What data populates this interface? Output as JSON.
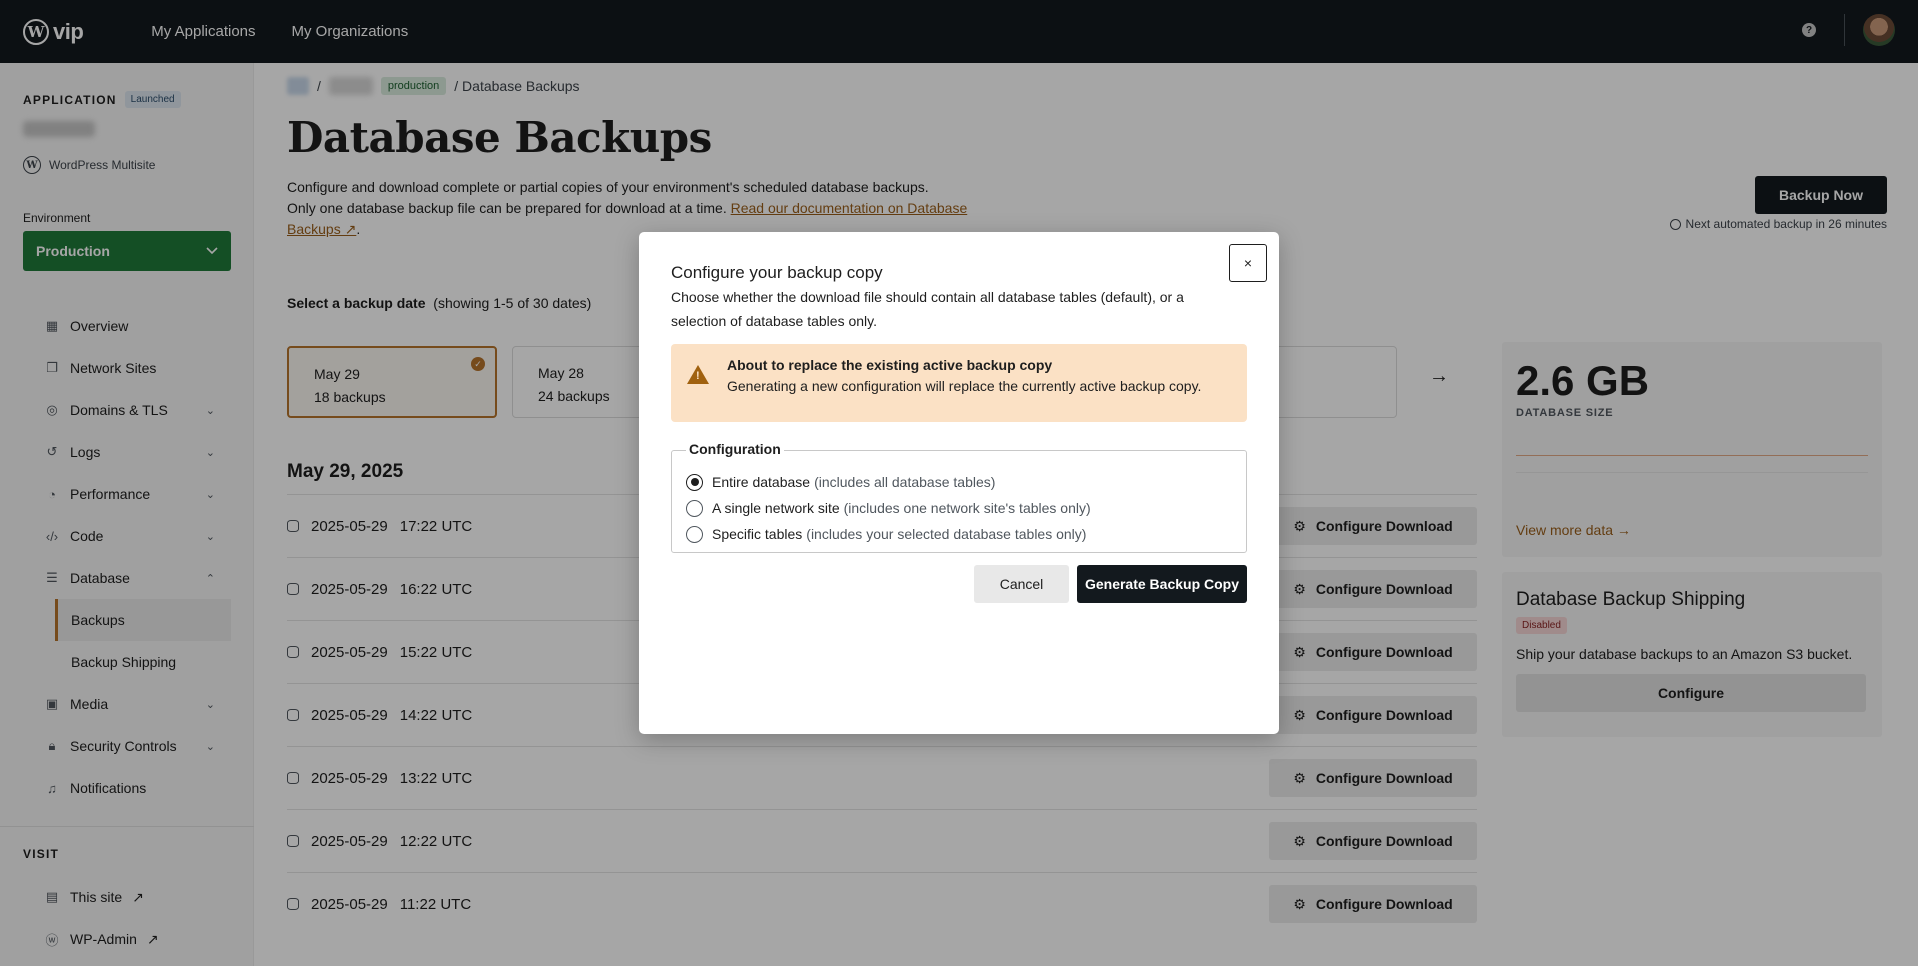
{
  "topbar": {
    "logo_text": "vip",
    "nav": [
      "My Applications",
      "My Organizations"
    ],
    "help_icon_glyph": "?"
  },
  "sidebar": {
    "application_label": "APPLICATION",
    "status_badge": "Launched",
    "app_type": "WordPress Multisite",
    "environment_label": "Environment",
    "environment_value": "Production",
    "nav": [
      {
        "label": "Overview",
        "icon": "overview-icon"
      },
      {
        "label": "Network Sites",
        "icon": "network-sites-icon"
      },
      {
        "label": "Domains & TLS",
        "icon": "globe-icon"
      },
      {
        "label": "Logs",
        "icon": "history-icon"
      },
      {
        "label": "Performance",
        "icon": "gauge-icon"
      },
      {
        "label": "Code",
        "icon": "code-icon"
      },
      {
        "label": "Database",
        "icon": "database-icon"
      },
      {
        "label": "Media",
        "icon": "media-icon"
      },
      {
        "label": "Security Controls",
        "icon": "lock-icon"
      },
      {
        "label": "Notifications",
        "icon": "bell-icon"
      }
    ],
    "database_sub": [
      "Backups",
      "Backup Shipping"
    ],
    "visit_label": "VISIT",
    "visit": [
      {
        "label": "This site",
        "icon": "layout-icon"
      },
      {
        "label": "WP-Admin",
        "icon": "wordpress-icon"
      }
    ]
  },
  "main": {
    "breadcrumb_env_badge": "production",
    "breadcrumb_current": "/ Database Backups",
    "title": "Database Backups",
    "description_line1": "Configure and download complete or partial copies of your environment's scheduled database backups.",
    "description_line2": "Only one database backup file can be prepared for download at a time. ",
    "doc_link": "Read our documentation on Database Backups ↗",
    "backup_now": "Backup Now",
    "next_backup": "Next automated backup in 26 minutes",
    "select_date_label": "Select a backup date",
    "select_date_count": "(showing 1-5 of 30 dates)",
    "date_cards": [
      {
        "date": "May 29",
        "count": "18 backups",
        "selected": true
      },
      {
        "date": "May 28",
        "count": "24 backups",
        "selected": false
      }
    ],
    "day_heading": "May 29, 2025",
    "backups": [
      {
        "date": "2025-05-29",
        "time": "17:22 UTC"
      },
      {
        "date": "2025-05-29",
        "time": "16:22 UTC"
      },
      {
        "date": "2025-05-29",
        "time": "15:22 UTC"
      },
      {
        "date": "2025-05-29",
        "time": "14:22 UTC"
      },
      {
        "date": "2025-05-29",
        "time": "13:22 UTC"
      },
      {
        "date": "2025-05-29",
        "time": "12:22 UTC"
      },
      {
        "date": "2025-05-29",
        "time": "11:22 UTC"
      }
    ],
    "configure_download_label": "Configure Download"
  },
  "stats": {
    "size": "2.6 GB",
    "size_label": "DATABASE SIZE",
    "view_more": "View more data →"
  },
  "shipping": {
    "title": "Database Backup Shipping",
    "badge": "Disabled",
    "description": "Ship your database backups to an Amazon S3 bucket.",
    "configure": "Configure"
  },
  "modal": {
    "close_glyph": "×",
    "title": "Configure your backup copy",
    "description": "Choose whether the download file should contain all database tables (default), or a selection of database tables only.",
    "warning_title": "About to replace the existing active backup copy",
    "warning_text": "Generating a new configuration will replace the currently active backup copy.",
    "legend": "Configuration",
    "options": [
      {
        "label": "Entire database",
        "hint": "(includes all database tables)",
        "checked": true
      },
      {
        "label": "A single network site",
        "hint": "(includes one network site's tables only)",
        "checked": false
      },
      {
        "label": "Specific tables",
        "hint": "(includes your selected database tables only)",
        "checked": false
      }
    ],
    "cancel": "Cancel",
    "generate": "Generate Backup Copy"
  }
}
